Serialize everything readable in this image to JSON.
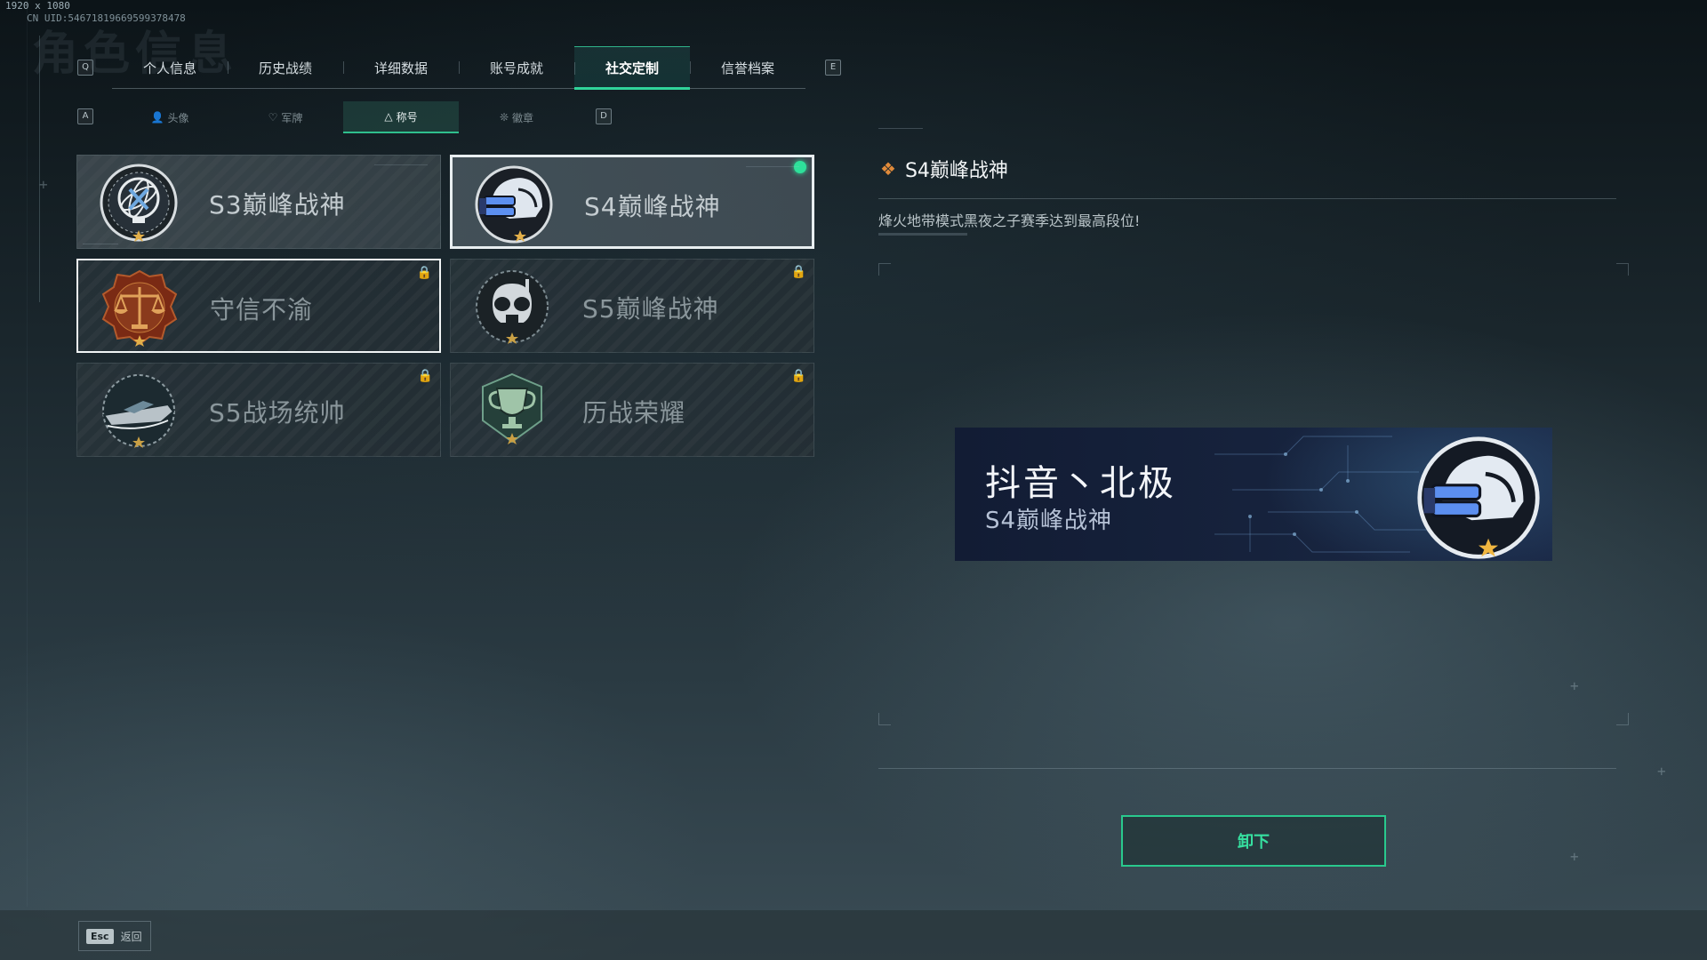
{
  "screen_info": {
    "resolution": "1920 x 1080",
    "uid": "CN UID:54671819669599378478"
  },
  "background_title": "角色信息",
  "key_hints": {
    "prev_tab": "Q",
    "next_tab": "E",
    "prev_sub": "A",
    "next_sub": "D"
  },
  "main_tabs": [
    {
      "label": "个人信息",
      "active": false
    },
    {
      "label": "历史战绩",
      "active": false
    },
    {
      "label": "详细数据",
      "active": false
    },
    {
      "label": "账号成就",
      "active": false
    },
    {
      "label": "社交定制",
      "active": true
    },
    {
      "label": "信誉档案",
      "active": false
    }
  ],
  "sub_tabs": [
    {
      "label": "头像",
      "icon": "person-icon",
      "active": false
    },
    {
      "label": "军牌",
      "icon": "dogtag-icon",
      "active": false
    },
    {
      "label": "称号",
      "icon": "title-icon",
      "active": true
    },
    {
      "label": "徽章",
      "icon": "emblem-icon",
      "active": false
    }
  ],
  "titles": [
    {
      "label": "S3巅峰战神",
      "icon": "armillary-sphere-icon",
      "locked": false,
      "equipped": false,
      "selected": false
    },
    {
      "label": "S4巅峰战神",
      "icon": "night-vision-helmet-icon",
      "locked": false,
      "equipped": true,
      "selected": true
    },
    {
      "label": "守信不渝",
      "icon": "scales-of-justice-icon",
      "locked": true,
      "equipped": false,
      "selected": false,
      "hovered": true
    },
    {
      "label": "S5巅峰战神",
      "icon": "skull-gasmask-icon",
      "locked": true,
      "equipped": false,
      "selected": false
    },
    {
      "label": "S5战场统帅",
      "icon": "speedboat-icon",
      "locked": true,
      "equipped": false,
      "selected": false
    },
    {
      "label": "历战荣耀",
      "icon": "trophy-icon",
      "locked": true,
      "equipped": false,
      "selected": false
    }
  ],
  "detail": {
    "title": "S4巅峰战神",
    "description": "烽火地带模式黑夜之子赛季达到最高段位!"
  },
  "nameplate": {
    "player_name": "抖音丶北极",
    "title": "S4巅峰战神"
  },
  "actions": {
    "unequip": "卸下"
  },
  "footer": {
    "esc_key": "Esc",
    "esc_label": "返回"
  },
  "colors": {
    "accent": "#2fd49a",
    "equipped_dot": "#2ee09a",
    "diamond": "#e08a3a"
  }
}
